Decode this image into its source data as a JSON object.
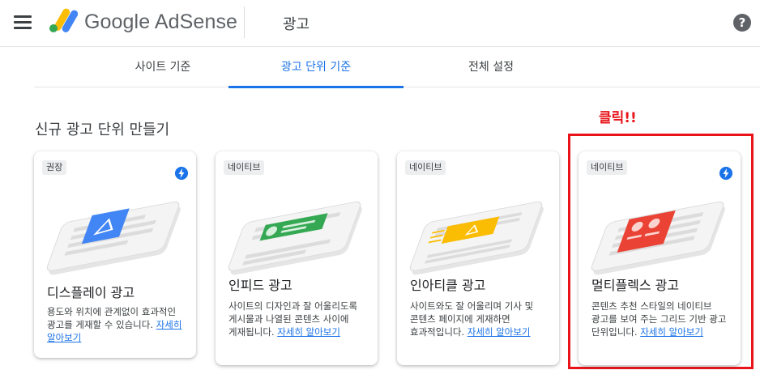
{
  "header": {
    "brand": "Google AdSense",
    "page_title": "광고",
    "help_label": "?"
  },
  "tabs": [
    {
      "label": "사이트 기준",
      "active": false
    },
    {
      "label": "광고 단위 기준",
      "active": true
    },
    {
      "label": "전체 설정",
      "active": false
    }
  ],
  "section_title": "신규 광고 단위 만들기",
  "annotation": "클릭!!",
  "cards": [
    {
      "badge": "권장",
      "bolt": true,
      "icon": "display-ad-illustration",
      "title": "디스플레이 광고",
      "desc": "용도와 위치에 관계없이 효과적인 광고를 게재할 수 있습니다.",
      "link": "자세히 알아보기"
    },
    {
      "badge": "네이티브",
      "bolt": false,
      "icon": "infeed-ad-illustration",
      "title": "인피드 광고",
      "desc": "사이트의 디자인과 잘 어울리도록 게시물과 나열된 콘텐츠 사이에 게재됩니다.",
      "link": "자세히 알아보기"
    },
    {
      "badge": "네이티브",
      "bolt": false,
      "icon": "in-article-ad-illustration",
      "title": "인아티클 광고",
      "desc": "사이트와도 잘 어울리며 기사 및 콘텐츠 페이지에 게재하면 효과적입니다.",
      "link": "자세히 알아보기"
    },
    {
      "badge": "네이티브",
      "bolt": true,
      "icon": "multiplex-ad-illustration",
      "title": "멀티플렉스 광고",
      "desc": "콘텐츠 추천 스타일의 네이티브 광고를 보여 주는 그리드 기반 광고 단위입니다.",
      "link": "자세히 알아보기"
    }
  ],
  "colors": {
    "accent": "#1a73e8",
    "display": "#4285f4",
    "infeed": "#34a853",
    "in_article": "#fbbc04",
    "multiplex": "#ea4335",
    "annotation": "#e8141a"
  }
}
